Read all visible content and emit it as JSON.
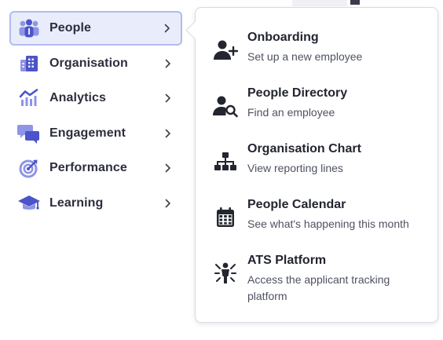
{
  "nav": {
    "items": [
      {
        "label": "People",
        "icon": "people-group-icon",
        "active": true
      },
      {
        "label": "Organisation",
        "icon": "building-icon",
        "active": false
      },
      {
        "label": "Analytics",
        "icon": "analytics-chart-icon",
        "active": false
      },
      {
        "label": "Engagement",
        "icon": "chat-bubbles-icon",
        "active": false
      },
      {
        "label": "Performance",
        "icon": "target-icon",
        "active": false
      },
      {
        "label": "Learning",
        "icon": "graduation-cap-icon",
        "active": false
      }
    ]
  },
  "panel": {
    "items": [
      {
        "title": "Onboarding",
        "description": "Set up a new employee",
        "icon": "user-plus-icon"
      },
      {
        "title": "People Directory",
        "description": "Find an employee",
        "icon": "user-search-icon"
      },
      {
        "title": "Organisation Chart",
        "description": "View reporting lines",
        "icon": "org-chart-icon"
      },
      {
        "title": "People Calendar",
        "description": "See what's happening this month",
        "icon": "calendar-icon"
      },
      {
        "title": "ATS Platform",
        "description": "Access the applicant tracking platform",
        "icon": "applicant-figure-icon"
      }
    ]
  },
  "colors": {
    "accent": "#4b54c8",
    "accent_light": "#8e95e6",
    "active_bg": "#e9ecfb",
    "active_border": "#b3baf0",
    "text_dark": "#23252f",
    "text_muted": "#4e5261"
  }
}
